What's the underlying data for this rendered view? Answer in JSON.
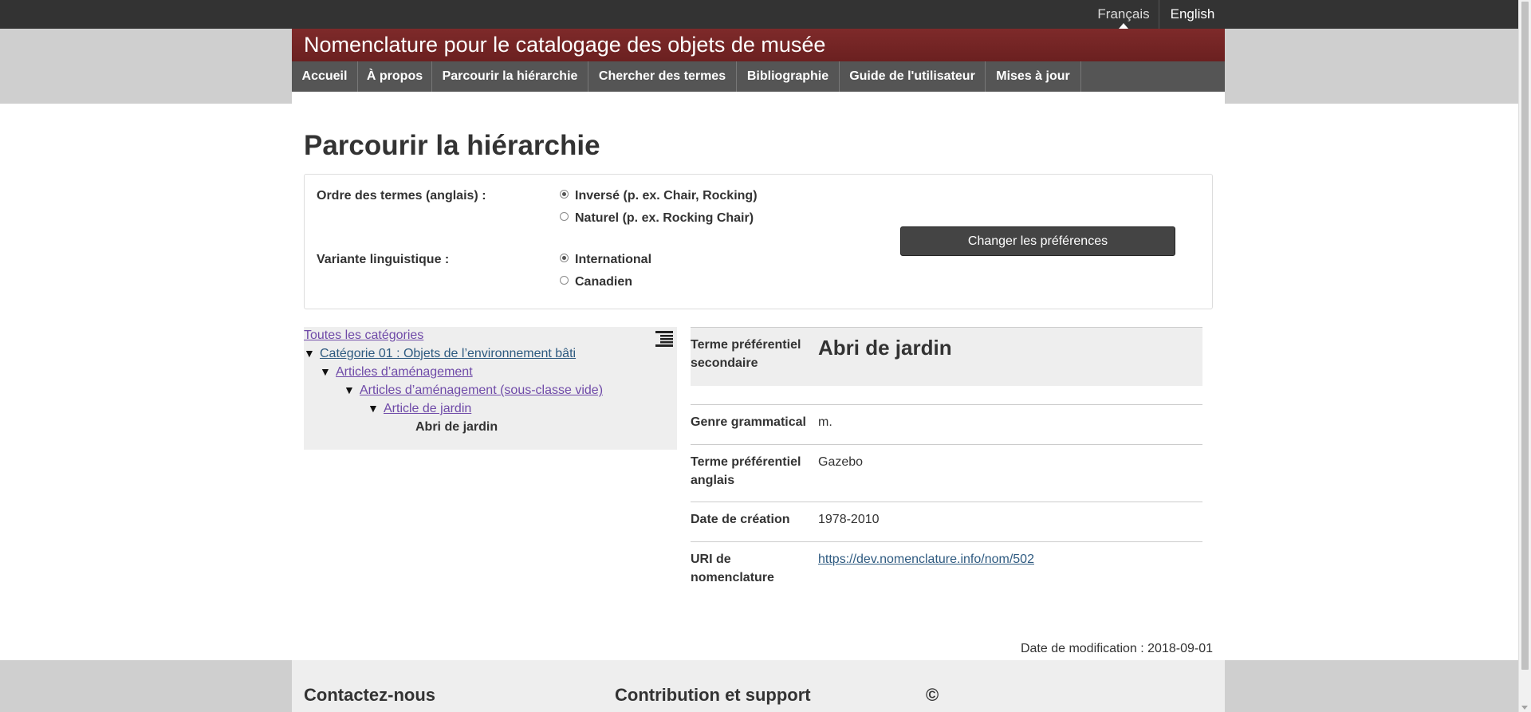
{
  "lang": {
    "francais": "Français",
    "english": "English"
  },
  "banner": {
    "title": "Nomenclature pour le catalogage des objets de musée"
  },
  "nav": [
    "Accueil",
    "À propos",
    "Parcourir la hiérarchie",
    "Chercher des termes",
    "Bibliographie",
    "Guide de l'utilisateur",
    "Mises à jour"
  ],
  "page_title": "Parcourir la hiérarchie",
  "prefs": {
    "order_label": "Ordre des termes (anglais) :",
    "order_inverse": "Inversé (p. ex. Chair, Rocking)",
    "order_natural": "Naturel (p. ex. Rocking Chair)",
    "variant_label": "Variante linguistique :",
    "variant_international": "International",
    "variant_canadian": "Canadien",
    "button": "Changer les préférences"
  },
  "tree": {
    "all": "Toutes les catégories",
    "cat01": "Catégorie 01 : Objets de l’environnement bâti",
    "amenagement": "Articles d’aménagement",
    "amenagement_sub": "Articles d’aménagement (sous-classe vide)",
    "jardin": "Article de jardin",
    "current": "Abri de jardin",
    "triangle": "▼"
  },
  "detail": {
    "secondary_label": "Terme préférentiel secondaire",
    "term": "Abri de jardin",
    "genre_label": "Genre grammatical",
    "genre_value": "m.",
    "english_label": "Terme préférentiel anglais",
    "english_value": "Gazebo",
    "date_label": "Date de création",
    "date_value": "1978-2010",
    "uri_label": "URI de nomenclature",
    "uri_value": "https://dev.nomenclature.info/nom/502"
  },
  "modified": "Date de modification : 2018-09-01",
  "footer": {
    "contact": "Contactez-nous",
    "contribution": "Contribution et support",
    "copyright": "©"
  }
}
